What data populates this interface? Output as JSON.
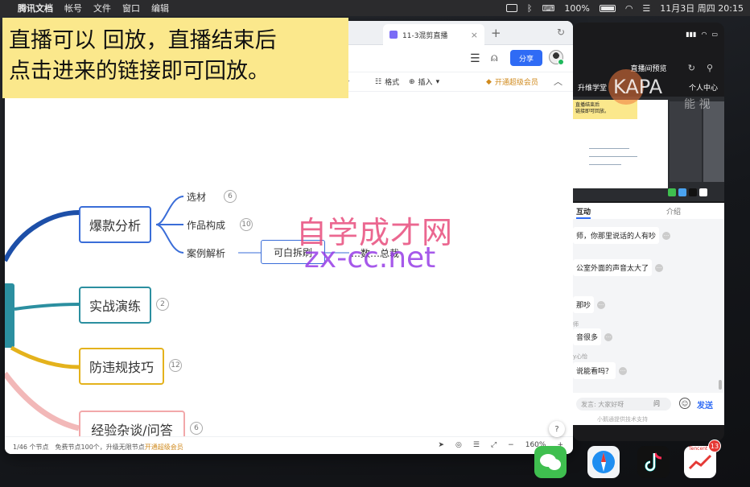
{
  "menubar": {
    "app_name": "腾讯文档",
    "items": [
      "帐号",
      "文件",
      "窗口",
      "编辑"
    ],
    "battery": "100%",
    "datetime": "11月3日 周四  20:15"
  },
  "window": {
    "tab_active": "11-3混剪直播",
    "toolbar": {
      "share": "分享",
      "format": "格式",
      "insert": "插入",
      "vip_link": "开通超级会员"
    },
    "status": {
      "nodes": "1/46 个节点",
      "free_note": "免费节点100个，升级无限节点",
      "upgrade": "开通超级会员",
      "zoom": "160%"
    },
    "help": "?"
  },
  "caption": {
    "line1": "直播可以 回放，直播结束后",
    "line2": "点击进来的链接即可回放。"
  },
  "mindmap": {
    "nodes": [
      {
        "label": "爆款分析",
        "color": "#3a6dd8",
        "badge": ""
      },
      {
        "label": "实战演练",
        "color": "#2b8fa0",
        "badge": "2"
      },
      {
        "label": "防违规技巧",
        "color": "#e4b21c",
        "badge": "12"
      },
      {
        "label": "经验杂谈/问答",
        "color": "#f2a8aa",
        "badge": "6"
      }
    ],
    "leaves": [
      {
        "label": "选材",
        "badge": "6"
      },
      {
        "label": "作品构成",
        "badge": "10"
      },
      {
        "label": "案例解析",
        "badge": ""
      }
    ],
    "sub_node": "可白拆刷",
    "partial_right": "…数…总裁"
  },
  "watermark": {
    "cn": "自学成才网",
    "en": "zx-cc.net"
  },
  "phone": {
    "header": "直播间预览",
    "brand": "升维学堂",
    "personal": "个人中心",
    "preview_caption": "直播结束后\n链接即可回放。",
    "tabs": [
      "互动",
      "介绍"
    ],
    "messages": [
      {
        "nick": "",
        "text": "师，你那里说话的人有吵"
      },
      {
        "nick": "",
        "text": "公室外面的声音太大了"
      },
      {
        "nick": "",
        "text": "那吵"
      },
      {
        "nick": "师",
        "text": "音很多"
      },
      {
        "nick": "y心怡",
        "text": "说能看吗？"
      }
    ],
    "input_placeholder": "发言: 大家好呀",
    "ask": "问",
    "send": "发送",
    "support": "小鹅通提供技术支持"
  },
  "dock": {
    "stock_badge": "13",
    "stock_label": "Tencent"
  },
  "colors": {
    "accent": "#2f6bf5",
    "caption_bg": "#fbe88c",
    "vip": "#d08a1d"
  }
}
